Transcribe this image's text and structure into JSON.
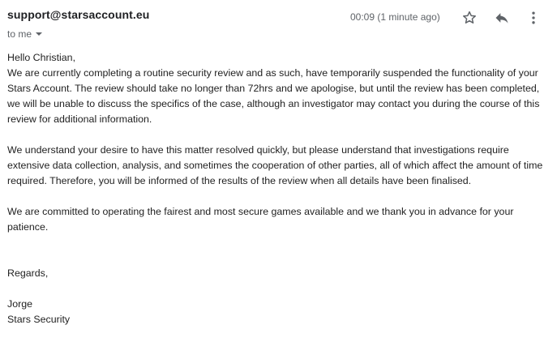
{
  "email": {
    "sender": "support@starsaccount.eu",
    "recipient_label": "to me",
    "timestamp": "00:09 (1 minute ago)",
    "icons": {
      "star": "star-outline-icon",
      "reply": "reply-icon",
      "more": "more-vertical-icon"
    },
    "body": {
      "greeting": "Hello Christian,",
      "paragraph1": "We are currently completing a routine security review and as such, have temporarily suspended the functionality of your Stars Account. The review should take no longer than 72hrs and we apologise, but until the review has been completed, we will be unable to discuss the specifics of the case, although an investigator may contact you during the course of this review for additional information.",
      "paragraph2": "We understand your desire to have this matter resolved quickly, but please understand that investigations require extensive data collection, analysis, and sometimes the cooperation of other parties, all of which affect the amount of time required. Therefore, you will be informed of the results of the review when all details have been finalised.",
      "paragraph3": "We are committed to operating the fairest and most secure games available and we thank you in advance for your patience.",
      "closing": "Regards,",
      "signature_name": "Jorge",
      "signature_team": "Stars Security"
    }
  },
  "colors": {
    "sender_text": "#202124",
    "meta_text": "#5f6368",
    "body_text": "#222222",
    "icon": "#5f6368"
  }
}
